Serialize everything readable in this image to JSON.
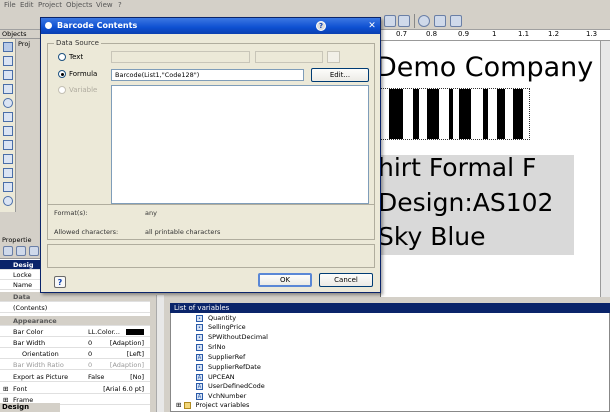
{
  "menu": [
    "File",
    "Edit",
    "Project",
    "Objects",
    "View",
    "?"
  ],
  "objects_panel": {
    "title": "Objects",
    "item_prefix": "Proj"
  },
  "ruler": [
    "0.7",
    "0.8",
    "0.9",
    "1",
    "1.1",
    "1.2",
    "1.3"
  ],
  "design": {
    "company": "Demo Company",
    "line1": "hirt Formal F",
    "line2": "Design:AS102",
    "line3": "Sky Blue"
  },
  "dialog": {
    "title": "Barcode Contents",
    "data_source_label": "Data Source",
    "text_label": "Text",
    "formula_label": "Formula",
    "variable_label": "Variable",
    "formula_value": "Barcode(List1,\"Code128\")",
    "edit_button": "Edit...",
    "formats_label": "Format(s):",
    "formats_value": "any",
    "allowed_label": "Allowed characters:",
    "allowed_value": "all printable characters",
    "ok": "OK",
    "cancel": "Cancel"
  },
  "properties": {
    "header": "Propertie",
    "rows": [
      {
        "name": "Desig",
        "value": "",
        "value2": "",
        "section": true
      },
      {
        "name": "Locke",
        "value": "",
        "value2": ""
      },
      {
        "name": "Name",
        "value": "",
        "value2": ""
      },
      {
        "name": "Data",
        "value": "",
        "value2": "",
        "section": true
      },
      {
        "name": "(Contents)",
        "value": "",
        "value2": ""
      },
      {
        "name": "Appearance",
        "value": "",
        "value2": "",
        "section": true
      },
      {
        "name": "Bar Color",
        "value": "LL.Color...",
        "value2": ""
      },
      {
        "name": "Bar Width",
        "value": "0",
        "value2": "[Adaption]"
      },
      {
        "name": "Orientation",
        "value": "0",
        "value2": "[Left]"
      },
      {
        "name": "Bar Width Ratio",
        "value": "0",
        "value2": "[Adaption]"
      },
      {
        "name": "Export as Picture",
        "value": "False",
        "value2": "[No]"
      },
      {
        "name": "Font",
        "value": "",
        "value2": "[Arial 6.0 pt]"
      },
      {
        "name": "Frame",
        "value": "",
        "value2": ""
      }
    ],
    "bottom_tab": "Design"
  },
  "variables": {
    "title": "List of variables",
    "items": [
      "Quantity",
      "SellingPrice",
      "SPWithoutDecimal",
      "SrlNo",
      "SupplierRef",
      "SupplierRefDate",
      "UPCEAN",
      "UserDefinedCode",
      "VchNumber"
    ],
    "project_vars": "Project variables"
  },
  "colors": {
    "title_bar": "#0d4fd1",
    "selection": "#0a246a"
  }
}
